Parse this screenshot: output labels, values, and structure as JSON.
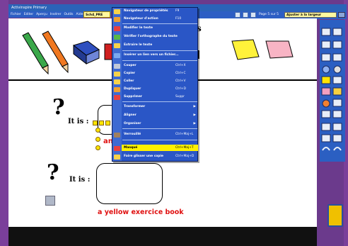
{
  "titlebar": {
    "title": "Activinspire  Primary"
  },
  "menu": [
    "Fichier",
    "Editer",
    "Aperçu",
    "Insérer",
    "Outils",
    "Aide"
  ],
  "document_tab": "Sch4_PRE",
  "toolbar": {
    "page_label": "Page 5 sur 5",
    "zoom": "Ajuster à la largeur"
  },
  "page": {
    "heading_fragment": "s",
    "question1": {
      "mark": "?",
      "label": "It is :",
      "red_fragment": "an"
    },
    "question2": {
      "mark": "?",
      "label": "It is :",
      "answer": "a yellow exercice book"
    }
  },
  "context_menu": {
    "items": [
      {
        "label": "Navigateur de propriétés",
        "shortcut": "F9",
        "submenu": false,
        "highlighted": false
      },
      {
        "label": "Navigateur d'action",
        "shortcut": "F10",
        "submenu": false,
        "highlighted": false
      },
      {
        "label": "Modifier le texte",
        "shortcut": "",
        "submenu": false,
        "highlighted": false
      },
      {
        "label": "Vérifier l'orthographe du texte",
        "shortcut": "",
        "submenu": false,
        "highlighted": false
      },
      {
        "label": "Extraire le texte",
        "shortcut": "",
        "submenu": false,
        "highlighted": false
      },
      {
        "label": "Insérer un lien vers un fichier...",
        "shortcut": "",
        "submenu": false,
        "highlighted": false
      },
      {
        "label": "Couper",
        "shortcut": "Ctrl+X",
        "submenu": false,
        "highlighted": false
      },
      {
        "label": "Copier",
        "shortcut": "Ctrl+C",
        "submenu": false,
        "highlighted": false
      },
      {
        "label": "Coller",
        "shortcut": "Ctrl+V",
        "submenu": false,
        "highlighted": false
      },
      {
        "label": "Dupliquer",
        "shortcut": "Ctrl+D",
        "submenu": false,
        "highlighted": false
      },
      {
        "label": "Supprimer",
        "shortcut": "Suppr",
        "submenu": false,
        "highlighted": false
      },
      {
        "label": "Transformer",
        "shortcut": "",
        "submenu": true,
        "highlighted": false
      },
      {
        "label": "Aligner",
        "shortcut": "",
        "submenu": true,
        "highlighted": false
      },
      {
        "label": "Organiser",
        "shortcut": "",
        "submenu": true,
        "highlighted": false
      },
      {
        "label": "Verrouillé",
        "shortcut": "Ctrl+Maj+L",
        "submenu": false,
        "highlighted": false
      },
      {
        "label": "Masqué",
        "shortcut": "Ctrl+Maj+T",
        "submenu": false,
        "highlighted": true
      },
      {
        "label": "Faire glisser une copie",
        "shortcut": "Ctrl+Maj+D",
        "submenu": false,
        "highlighted": false
      }
    ]
  },
  "colors": {
    "accent": "#2a56c6",
    "highlight": "#fff200",
    "answer": "#e01010",
    "frame": "#7a3f9a"
  }
}
